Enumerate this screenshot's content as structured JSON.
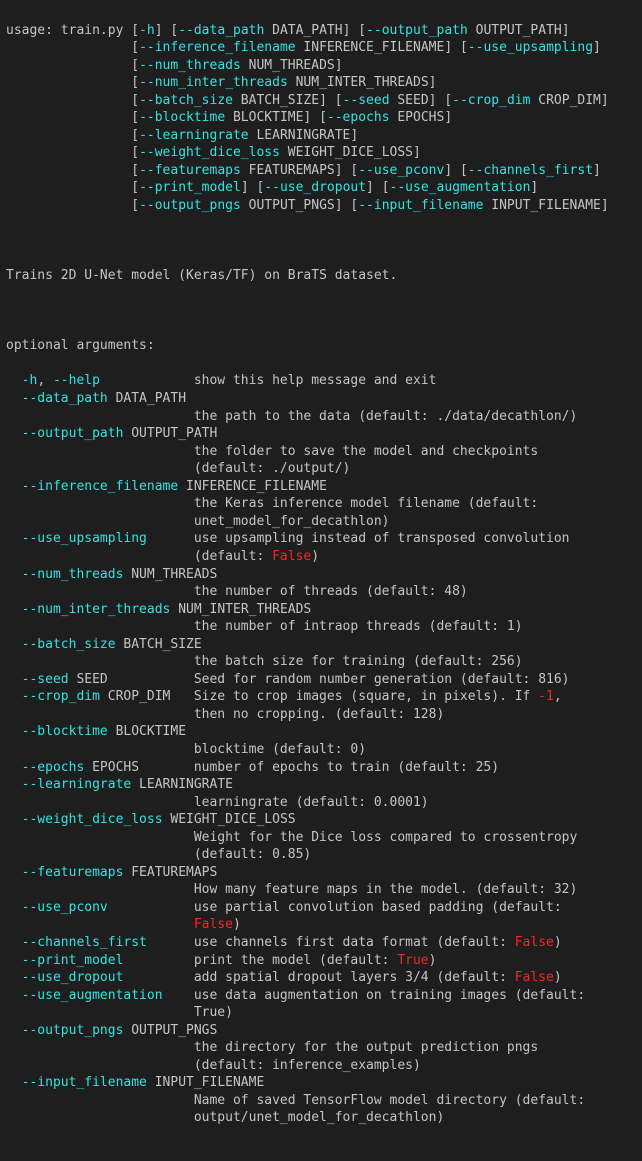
{
  "usage": {
    "prefix": "usage: train.py ",
    "lines": [
      [
        {
          "t": "[",
          "c": ""
        },
        {
          "t": "-h",
          "c": "flag"
        },
        {
          "t": "] [",
          "c": ""
        },
        {
          "t": "--data_path",
          "c": "flag"
        },
        {
          "t": " DATA_PATH] [",
          "c": ""
        },
        {
          "t": "--output_path",
          "c": "flag"
        },
        {
          "t": " OUTPUT_PATH]",
          "c": ""
        }
      ],
      [
        {
          "t": "[",
          "c": ""
        },
        {
          "t": "--inference_filename",
          "c": "flag"
        },
        {
          "t": " INFERENCE_FILENAME] [",
          "c": ""
        },
        {
          "t": "--use_upsampling",
          "c": "flag"
        },
        {
          "t": "]",
          "c": ""
        }
      ],
      [
        {
          "t": "[",
          "c": ""
        },
        {
          "t": "--num_threads",
          "c": "flag"
        },
        {
          "t": " NUM_THREADS]",
          "c": ""
        }
      ],
      [
        {
          "t": "[",
          "c": ""
        },
        {
          "t": "--num_inter_threads",
          "c": "flag"
        },
        {
          "t": " NUM_INTER_THREADS]",
          "c": ""
        }
      ],
      [
        {
          "t": "[",
          "c": ""
        },
        {
          "t": "--batch_size",
          "c": "flag"
        },
        {
          "t": " BATCH_SIZE] [",
          "c": ""
        },
        {
          "t": "--seed",
          "c": "flag"
        },
        {
          "t": " SEED] [",
          "c": ""
        },
        {
          "t": "--crop_dim",
          "c": "flag"
        },
        {
          "t": " CROP_DIM]",
          "c": ""
        }
      ],
      [
        {
          "t": "[",
          "c": ""
        },
        {
          "t": "--blocktime",
          "c": "flag"
        },
        {
          "t": " BLOCKTIME] [",
          "c": ""
        },
        {
          "t": "--epochs",
          "c": "flag"
        },
        {
          "t": " EPOCHS]",
          "c": ""
        }
      ],
      [
        {
          "t": "[",
          "c": ""
        },
        {
          "t": "--learningrate",
          "c": "flag"
        },
        {
          "t": " LEARNINGRATE]",
          "c": ""
        }
      ],
      [
        {
          "t": "[",
          "c": ""
        },
        {
          "t": "--weight_dice_loss",
          "c": "flag"
        },
        {
          "t": " WEIGHT_DICE_LOSS]",
          "c": ""
        }
      ],
      [
        {
          "t": "[",
          "c": ""
        },
        {
          "t": "--featuremaps",
          "c": "flag"
        },
        {
          "t": " FEATUREMAPS] [",
          "c": ""
        },
        {
          "t": "--use_pconv",
          "c": "flag"
        },
        {
          "t": "] [",
          "c": ""
        },
        {
          "t": "--channels_first",
          "c": "flag"
        },
        {
          "t": "]",
          "c": ""
        }
      ],
      [
        {
          "t": "[",
          "c": ""
        },
        {
          "t": "--print_model",
          "c": "flag"
        },
        {
          "t": "] [",
          "c": ""
        },
        {
          "t": "--use_dropout",
          "c": "flag"
        },
        {
          "t": "] [",
          "c": ""
        },
        {
          "t": "--use_augmentation",
          "c": "flag"
        },
        {
          "t": "]",
          "c": ""
        }
      ],
      [
        {
          "t": "[",
          "c": ""
        },
        {
          "t": "--output_pngs",
          "c": "flag"
        },
        {
          "t": " OUTPUT_PNGS] [",
          "c": ""
        },
        {
          "t": "--input_filename",
          "c": "flag"
        },
        {
          "t": " INPUT_FILENAME]",
          "c": ""
        }
      ]
    ]
  },
  "description": "Trains 2D U-Net model (Keras/TF) on BraTS dataset.",
  "section_header": "optional arguments:",
  "args": [
    {
      "flag_segments": [
        {
          "t": "-h",
          "c": "flag"
        },
        {
          "t": ", ",
          "c": ""
        },
        {
          "t": "--help",
          "c": "flag"
        }
      ],
      "meta": "",
      "desc_segments": [
        {
          "t": "show this help message and exit",
          "c": ""
        }
      ],
      "two_line": false
    },
    {
      "flag_segments": [
        {
          "t": "--data_path",
          "c": "flag"
        }
      ],
      "meta": " DATA_PATH",
      "desc_segments": [
        {
          "t": "the path to the data (default: ./data/decathlon/)",
          "c": ""
        }
      ],
      "two_line": true
    },
    {
      "flag_segments": [
        {
          "t": "--output_path",
          "c": "flag"
        }
      ],
      "meta": " OUTPUT_PATH",
      "desc_segments": [
        {
          "t": "the folder to save the model and checkpoints (default: ./output/)",
          "c": ""
        }
      ],
      "two_line": true
    },
    {
      "flag_segments": [
        {
          "t": "--inference_filename",
          "c": "flag"
        }
      ],
      "meta": " INFERENCE_FILENAME",
      "desc_segments": [
        {
          "t": "the Keras inference model filename (default: unet_model_for_decathlon)",
          "c": ""
        }
      ],
      "two_line": true
    },
    {
      "flag_segments": [
        {
          "t": "--use_upsampling",
          "c": "flag"
        }
      ],
      "meta": "",
      "desc_segments": [
        {
          "t": "use upsampling instead of transposed convolution (default: ",
          "c": ""
        },
        {
          "t": "False",
          "c": "lit"
        },
        {
          "t": ")",
          "c": ""
        }
      ],
      "two_line": false
    },
    {
      "flag_segments": [
        {
          "t": "--num_threads",
          "c": "flag"
        }
      ],
      "meta": " NUM_THREADS",
      "desc_segments": [
        {
          "t": "the number of threads (default: 48)",
          "c": ""
        }
      ],
      "two_line": true
    },
    {
      "flag_segments": [
        {
          "t": "--num_inter_threads",
          "c": "flag"
        }
      ],
      "meta": " NUM_INTER_THREADS",
      "desc_segments": [
        {
          "t": "the number of intraop threads (default: 1)",
          "c": ""
        }
      ],
      "two_line": true
    },
    {
      "flag_segments": [
        {
          "t": "--batch_size",
          "c": "flag"
        }
      ],
      "meta": " BATCH_SIZE",
      "desc_segments": [
        {
          "t": "the batch size for training (default: 256)",
          "c": ""
        }
      ],
      "two_line": true
    },
    {
      "flag_segments": [
        {
          "t": "--seed",
          "c": "flag"
        }
      ],
      "meta": " SEED",
      "desc_segments": [
        {
          "t": "Seed for random number generation (default: 816)",
          "c": ""
        }
      ],
      "two_line": false
    },
    {
      "flag_segments": [
        {
          "t": "--crop_dim",
          "c": "flag"
        }
      ],
      "meta": " CROP_DIM",
      "desc_segments": [
        {
          "t": "Size to crop images (square, in pixels). If ",
          "c": ""
        },
        {
          "t": "-1",
          "c": "lit"
        },
        {
          "t": ", then no cropping. (default: 128)",
          "c": ""
        }
      ],
      "two_line": false
    },
    {
      "flag_segments": [
        {
          "t": "--blocktime",
          "c": "flag"
        }
      ],
      "meta": " BLOCKTIME",
      "desc_segments": [
        {
          "t": "blocktime (default: 0)",
          "c": ""
        }
      ],
      "two_line": true
    },
    {
      "flag_segments": [
        {
          "t": "--epochs",
          "c": "flag"
        }
      ],
      "meta": " EPOCHS",
      "desc_segments": [
        {
          "t": "number of epochs to train (default: 25)",
          "c": ""
        }
      ],
      "two_line": false
    },
    {
      "flag_segments": [
        {
          "t": "--learningrate",
          "c": "flag"
        }
      ],
      "meta": " LEARNINGRATE",
      "desc_segments": [
        {
          "t": "learningrate (default: 0.0001)",
          "c": ""
        }
      ],
      "two_line": true
    },
    {
      "flag_segments": [
        {
          "t": "--weight_dice_loss",
          "c": "flag"
        }
      ],
      "meta": " WEIGHT_DICE_LOSS",
      "desc_segments": [
        {
          "t": "Weight for the Dice loss compared to crossentropy (default: 0.85)",
          "c": ""
        }
      ],
      "two_line": true
    },
    {
      "flag_segments": [
        {
          "t": "--featuremaps",
          "c": "flag"
        }
      ],
      "meta": " FEATUREMAPS",
      "desc_segments": [
        {
          "t": "How many feature maps in the model. (default: 32)",
          "c": ""
        }
      ],
      "two_line": true
    },
    {
      "flag_segments": [
        {
          "t": "--use_pconv",
          "c": "flag"
        }
      ],
      "meta": "",
      "desc_segments": [
        {
          "t": "use partial convolution based padding (default: ",
          "c": ""
        },
        {
          "t": "False",
          "c": "lit"
        },
        {
          "t": ")",
          "c": ""
        }
      ],
      "two_line": false
    },
    {
      "flag_segments": [
        {
          "t": "--channels_first",
          "c": "flag"
        }
      ],
      "meta": "",
      "desc_segments": [
        {
          "t": "use channels first data format (default: ",
          "c": ""
        },
        {
          "t": "False",
          "c": "lit"
        },
        {
          "t": ")",
          "c": ""
        }
      ],
      "two_line": false
    },
    {
      "flag_segments": [
        {
          "t": "--print_model",
          "c": "flag"
        }
      ],
      "meta": "",
      "desc_segments": [
        {
          "t": "print the model (default: ",
          "c": ""
        },
        {
          "t": "True",
          "c": "lit"
        },
        {
          "t": ")",
          "c": ""
        }
      ],
      "two_line": false
    },
    {
      "flag_segments": [
        {
          "t": "--use_dropout",
          "c": "flag"
        }
      ],
      "meta": "",
      "desc_segments": [
        {
          "t": "add spatial dropout layers 3/4 (default: ",
          "c": ""
        },
        {
          "t": "False",
          "c": "lit"
        },
        {
          "t": ")",
          "c": ""
        }
      ],
      "two_line": false
    },
    {
      "flag_segments": [
        {
          "t": "--use_augmentation",
          "c": "flag"
        }
      ],
      "meta": "",
      "desc_segments": [
        {
          "t": "use data augmentation on training images (default: True)",
          "c": ""
        }
      ],
      "two_line": false
    },
    {
      "flag_segments": [
        {
          "t": "--output_pngs",
          "c": "flag"
        }
      ],
      "meta": " OUTPUT_PNGS",
      "desc_segments": [
        {
          "t": "the directory for the output prediction pngs (default: inference_examples)",
          "c": ""
        }
      ],
      "two_line": true
    },
    {
      "flag_segments": [
        {
          "t": "--input_filename",
          "c": "flag"
        }
      ],
      "meta": " INPUT_FILENAME",
      "desc_segments": [
        {
          "t": "Name of saved TensorFlow model directory (default: output/unet_model_for_decathlon)",
          "c": ""
        }
      ],
      "two_line": true
    }
  ]
}
